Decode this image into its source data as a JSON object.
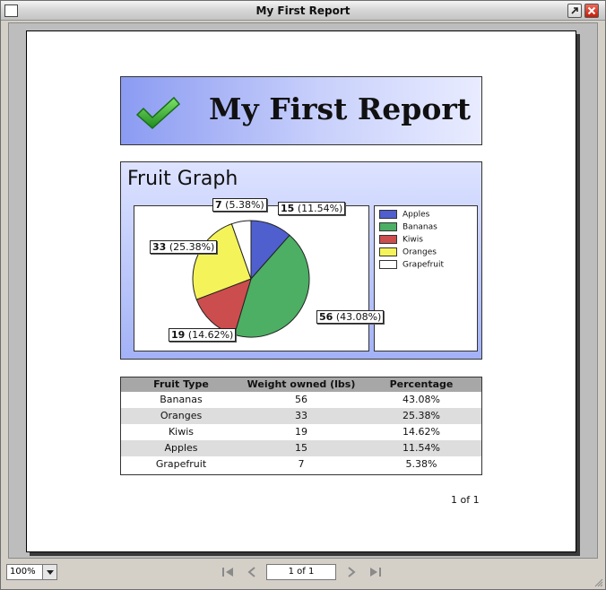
{
  "window": {
    "title": "My First Report"
  },
  "report": {
    "title": "My First Report",
    "graph_title": "Fruit Graph",
    "page_number": "1 of 1"
  },
  "legend": [
    "Apples",
    "Bananas",
    "Kiwis",
    "Oranges",
    "Grapefruit"
  ],
  "pie_labels": {
    "apples": {
      "value": "15",
      "pct": "(11.54%)"
    },
    "bananas": {
      "value": "56",
      "pct": "(43.08%)"
    },
    "kiwis": {
      "value": "19",
      "pct": "(14.62%)"
    },
    "oranges": {
      "value": "33",
      "pct": "(25.38%)"
    },
    "grapefruit": {
      "value": "7",
      "pct": "(5.38%)"
    }
  },
  "table": {
    "headers": [
      "Fruit Type",
      "Weight owned (lbs)",
      "Percentage"
    ],
    "rows": [
      [
        "Bananas",
        "56",
        "43.08%"
      ],
      [
        "Oranges",
        "33",
        "25.38%"
      ],
      [
        "Kiwis",
        "19",
        "14.62%"
      ],
      [
        "Apples",
        "15",
        "11.54%"
      ],
      [
        "Grapefruit",
        "7",
        "5.38%"
      ]
    ]
  },
  "chart_data": {
    "type": "pie",
    "categories": [
      "Apples",
      "Bananas",
      "Kiwis",
      "Oranges",
      "Grapefruit"
    ],
    "values": [
      15,
      56,
      19,
      33,
      7
    ],
    "percentages": [
      11.54,
      43.08,
      14.62,
      25.38,
      5.38
    ],
    "colors": [
      "#4f5fce",
      "#4caf64",
      "#cc4d4d",
      "#f4f45a",
      "#ffffff"
    ],
    "title": "Fruit Graph",
    "legend": "right"
  },
  "toolbar": {
    "zoom": "100%",
    "page_field": "1 of 1"
  },
  "colors": {
    "header_gradient_start": "#8b9bf2",
    "header_gradient_end": "#e9ecff",
    "table_header": "#a7a7a7",
    "table_alt_row": "#dddddd"
  }
}
